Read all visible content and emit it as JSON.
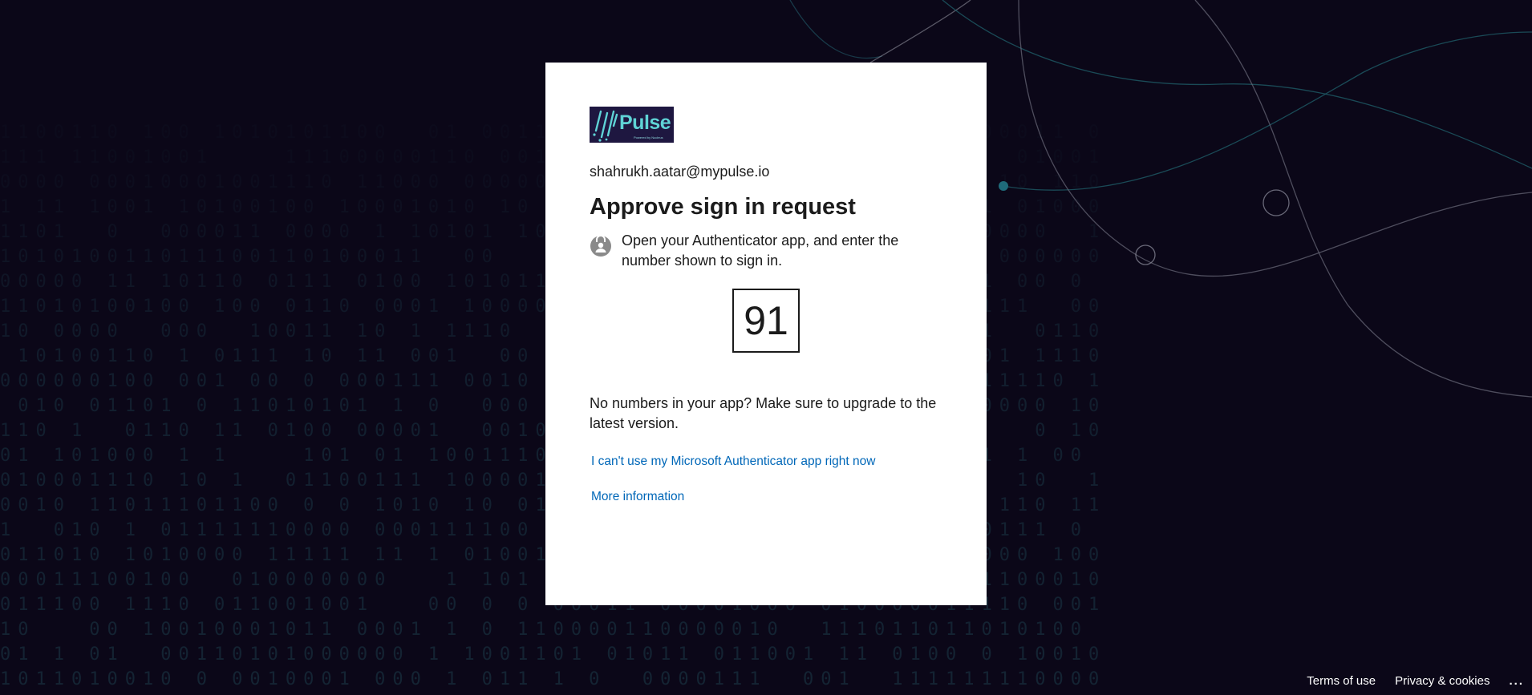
{
  "background": {
    "color": "#0b0718",
    "pattern": "binary digits with curved teal lines"
  },
  "card": {
    "logo": {
      "brand_text": "Pulse",
      "tagline": "Powered by Nucleus"
    },
    "identity": "shahrukh.aatar@mypulse.io",
    "title": "Approve sign in request",
    "instruction_icon": "authenticator-lock-icon",
    "instruction": "Open your Authenticator app, and enter the number shown to sign in.",
    "number": "91",
    "upgrade_text": "No numbers in your app? Make sure to upgrade to the latest version.",
    "cant_use_link": "I can't use my Microsoft Authenticator app right now",
    "more_info_link": "More information"
  },
  "footer": {
    "terms": "Terms of use",
    "privacy": "Privacy & cookies",
    "more": "..."
  },
  "colors": {
    "link": "#0067b8",
    "text": "#1b1b1b",
    "logo_bg": "#1e1740",
    "logo_text": "#5fd3d6"
  }
}
